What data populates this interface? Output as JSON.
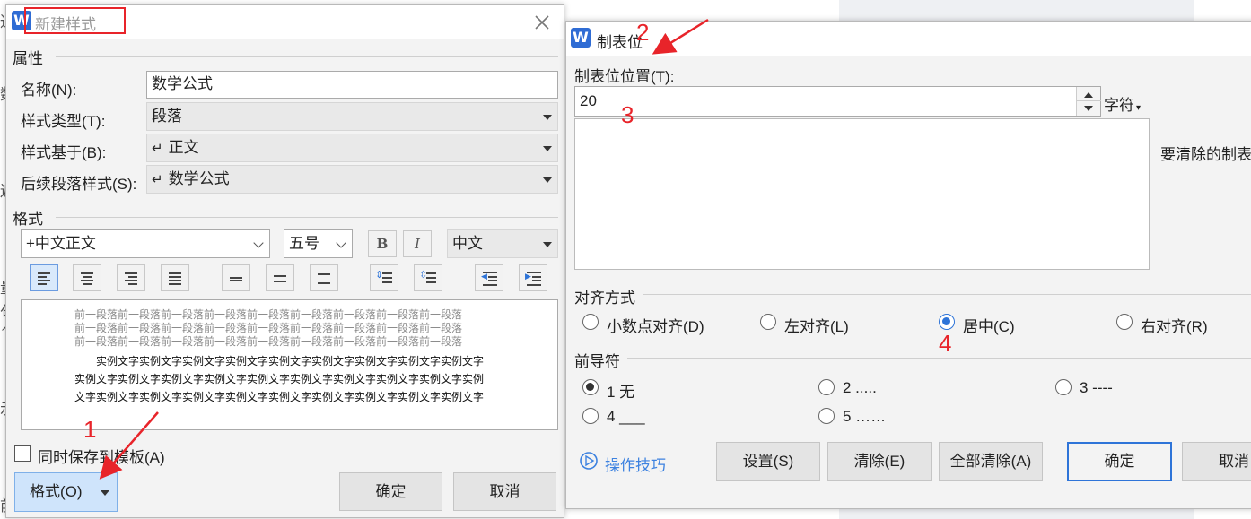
{
  "background": {
    "left_chars": [
      "通",
      "",
      "",
      "数",
      "",
      "",
      "",
      "遍",
      "",
      "",
      "",
      "量",
      "句",
      "^",
      "",
      "",
      "示",
      "",
      "",
      "",
      "前"
    ]
  },
  "style_dialog": {
    "title": "新建样式",
    "properties": {
      "section": "属性",
      "name_label": "名称(N):",
      "name_value": "数学公式",
      "type_label": "样式类型(T):",
      "type_value": "段落",
      "based_label": "样式基于(B):",
      "based_value": "正文",
      "next_label": "后续段落样式(S):",
      "next_value": "数学公式"
    },
    "format": {
      "section": "格式",
      "font": "+中文正文",
      "size": "五号",
      "bold": "B",
      "italic": "I",
      "script": "中文"
    },
    "preview": {
      "prev_lines": [
        "前一段落前一段落前一段落前一段落前一段落前一段落前一段落前一段落前一段落",
        "前一段落前一段落前一段落前一段落前一段落前一段落前一段落前一段落前一段落",
        "前一段落前一段落前一段落前一段落前一段落前一段落前一段落前一段落前一段落"
      ],
      "sample_lines": [
        "实例文字实例文字实例文字实例文字实例文字实例文字实例文字实例文字实例文字",
        "实例文字实例文字实例文字实例文字实例文字实例文字实例文字实例文字实例文字实例",
        "文字实例文字实例文字实例文字实例文字实例文字实例文字实例文字实例文字实例文字"
      ]
    },
    "save_to_template": "同时保存到模板(A)",
    "format_button": "格式(O)",
    "ok": "确定",
    "cancel": "取消"
  },
  "tab_dialog": {
    "title": "制表位",
    "position_label": "制表位位置(T):",
    "position_value": "20",
    "unit": "字符",
    "clear_label": "要清除的制表",
    "align": {
      "section": "对齐方式",
      "options": [
        "小数点对齐(D)",
        "左对齐(L)",
        "居中(C)",
        "右对齐(R)"
      ],
      "selected": "居中(C)"
    },
    "leader": {
      "section": "前导符",
      "options": [
        "1 无",
        "2 .....",
        "3 ----",
        "4 ___",
        "5 ……"
      ],
      "selected": "1 无"
    },
    "tips": "操作技巧",
    "set": "设置(S)",
    "clear": "清除(E)",
    "clear_all": "全部清除(A)",
    "ok": "确定",
    "cancel": "取消"
  },
  "annotations": [
    "1",
    "2",
    "3",
    "4"
  ],
  "colors": {
    "accent": "#2e74d8",
    "annotation": "#e8242a",
    "logo": "#2f6cd4"
  }
}
